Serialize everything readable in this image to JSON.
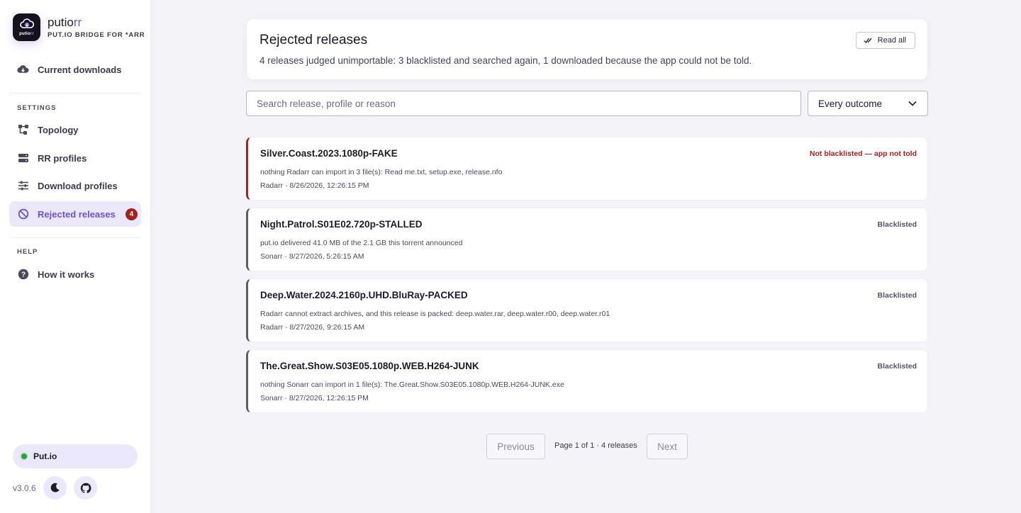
{
  "brand": {
    "logo_word_a": "putio",
    "logo_word_b": "rr",
    "name_a": "putio",
    "name_b": "rr",
    "tagline": "PUT.IO BRIDGE FOR *ARR",
    "accent_color": "#6d4fe0"
  },
  "sidebar": {
    "primary": [
      {
        "label": "Current downloads",
        "icon": "cloud-download-icon"
      }
    ],
    "sections": [
      {
        "title": "SETTINGS",
        "items": [
          {
            "label": "Topology",
            "icon": "topology-icon"
          },
          {
            "label": "RR profiles",
            "icon": "server-icon"
          },
          {
            "label": "Download profiles",
            "icon": "sliders-icon"
          },
          {
            "label": "Rejected releases",
            "icon": "ban-icon",
            "active": true,
            "badge": "4"
          }
        ]
      },
      {
        "title": "HELP",
        "items": [
          {
            "label": "How it works",
            "icon": "help-circle-icon"
          }
        ]
      }
    ],
    "status": {
      "label": "Put.io",
      "color": "#2f9e44"
    },
    "version": "v3.0.6",
    "theme_toggle_icon": "moon-icon",
    "github_icon": "github-icon"
  },
  "header": {
    "title": "Rejected releases",
    "summary": "4 releases judged unimportable: 3 blacklisted and searched again, 1 downloaded because the app could not be told.",
    "read_all_label": "Read all",
    "read_all_icon": "check-double-icon"
  },
  "filters": {
    "search_placeholder": "Search release, profile or reason",
    "search_value": "",
    "outcome_selected": "Every outcome"
  },
  "releases": [
    {
      "name": "Silver.Coast.2023.1080p-FAKE",
      "reason": "nothing Radarr can import in 3 file(s): Read me.txt, setup.exe, release.nfo",
      "meta": "Radarr · 8/26/2026, 12:26:15 PM",
      "outcome": "Not blacklisted — app not told",
      "warn": true
    },
    {
      "name": "Night.Patrol.S01E02.720p-STALLED",
      "reason": "put.io delivered 41.0 MB of the 2.1 GB this torrent announced",
      "meta": "Sonarr · 8/27/2026, 5:26:15 AM",
      "outcome": "Blacklisted",
      "warn": false
    },
    {
      "name": "Deep.Water.2024.2160p.UHD.BluRay-PACKED",
      "reason": "Radarr cannot extract archives, and this release is packed: deep.water.rar, deep.water.r00, deep.water.r01",
      "meta": "Radarr · 8/27/2026, 9:26:15 AM",
      "outcome": "Blacklisted",
      "warn": false
    },
    {
      "name": "The.Great.Show.S03E05.1080p.WEB.H264-JUNK",
      "reason": "nothing Sonarr can import in 1 file(s): The.Great.Show.S03E05.1080p.WEB.H264-JUNK.exe",
      "meta": "Sonarr · 8/27/2026, 12:26:15 PM",
      "outcome": "Blacklisted",
      "warn": false
    }
  ],
  "pagination": {
    "previous_label": "Previous",
    "info": "Page 1 of 1 · 4 releases",
    "next_label": "Next"
  },
  "colors": {
    "warn": "#a7221c",
    "neutral_border": "#5b5b6e"
  }
}
